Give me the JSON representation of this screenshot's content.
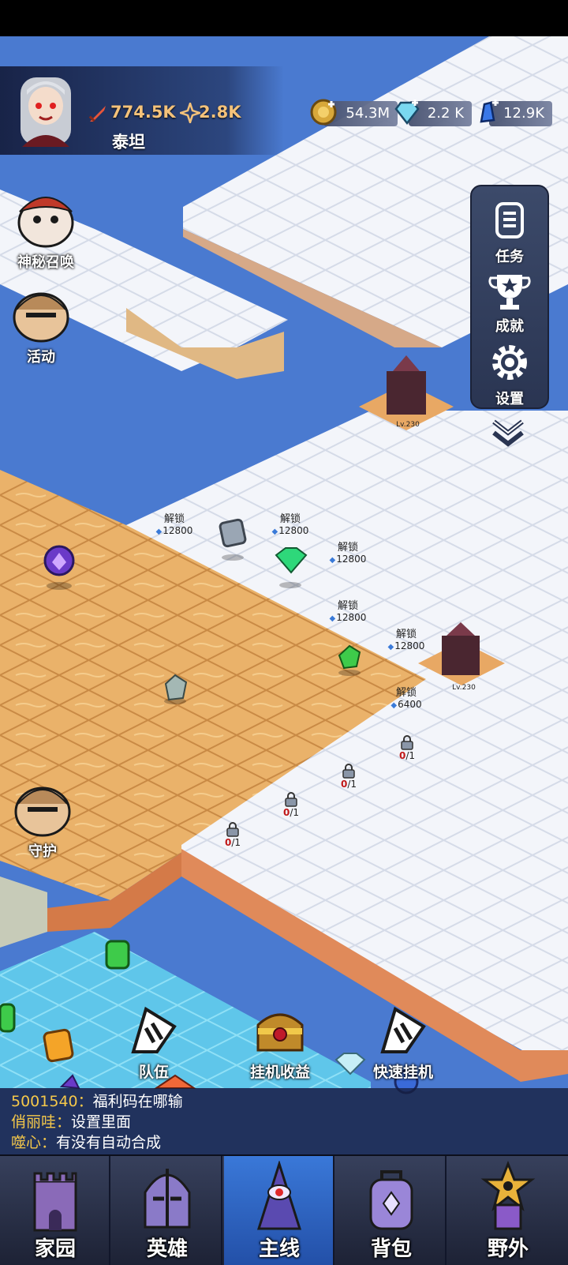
{
  "player": {
    "name": "泰坦",
    "power": "774.5K",
    "power_icon": "sword-icon",
    "secondary": "2.8K",
    "secondary_icon": "star-compass-icon"
  },
  "resources": [
    {
      "icon": "gold-coin-icon",
      "value": "54.3M"
    },
    {
      "icon": "diamond-icon",
      "value": "2.2 K"
    },
    {
      "icon": "crystal-shard-icon",
      "value": "12.9K"
    }
  ],
  "left_buttons": [
    {
      "label": "神秘召唤",
      "icon": "summon-icon"
    },
    {
      "label": "活动",
      "icon": "event-icon"
    },
    {
      "label": "守护",
      "icon": "guard-icon"
    }
  ],
  "right_panel": [
    {
      "label": "任务",
      "icon": "quest-scroll-icon"
    },
    {
      "label": "成就",
      "icon": "trophy-icon"
    },
    {
      "label": "设置",
      "icon": "gear-icon"
    }
  ],
  "map": {
    "unlock_label": "解锁",
    "unlock_costs": [
      "12800",
      "12800",
      "12800",
      "12800",
      "12800",
      "6400"
    ],
    "locks": [
      {
        "count": "0",
        "total": "/1"
      },
      {
        "count": "0",
        "total": "/1"
      },
      {
        "count": "0",
        "total": "/1"
      },
      {
        "count": "0",
        "total": "/1"
      }
    ],
    "tower_level": "Lv.230"
  },
  "bottom_actions": [
    {
      "label": "队伍",
      "icon": "flag-icon"
    },
    {
      "label": "挂机收益",
      "icon": "treasure-chest-icon"
    },
    {
      "label": "快速挂机",
      "icon": "flag-icon"
    }
  ],
  "chat": [
    {
      "user": "5001540：",
      "msg": "福利码在哪输"
    },
    {
      "user": "俏丽哇：",
      "msg": "设置里面"
    },
    {
      "user": "噬心：",
      "msg": "有没有自动合成"
    }
  ],
  "nav": [
    {
      "label": "家园",
      "icon": "castle-icon"
    },
    {
      "label": "英雄",
      "icon": "helmet-icon"
    },
    {
      "label": "主线",
      "icon": "eye-tower-icon"
    },
    {
      "label": "背包",
      "icon": "backpack-icon"
    },
    {
      "label": "野外",
      "icon": "wild-star-icon"
    }
  ],
  "nav_active_index": 2,
  "colors": {
    "snow": "#f3f5fa",
    "sand": "#eab26a",
    "ice": "#5fc6ea",
    "water": "#4a7ad0",
    "accent": "#2f6ad0",
    "chat_user": "#f5c84a",
    "lock_count": "#c01818"
  }
}
